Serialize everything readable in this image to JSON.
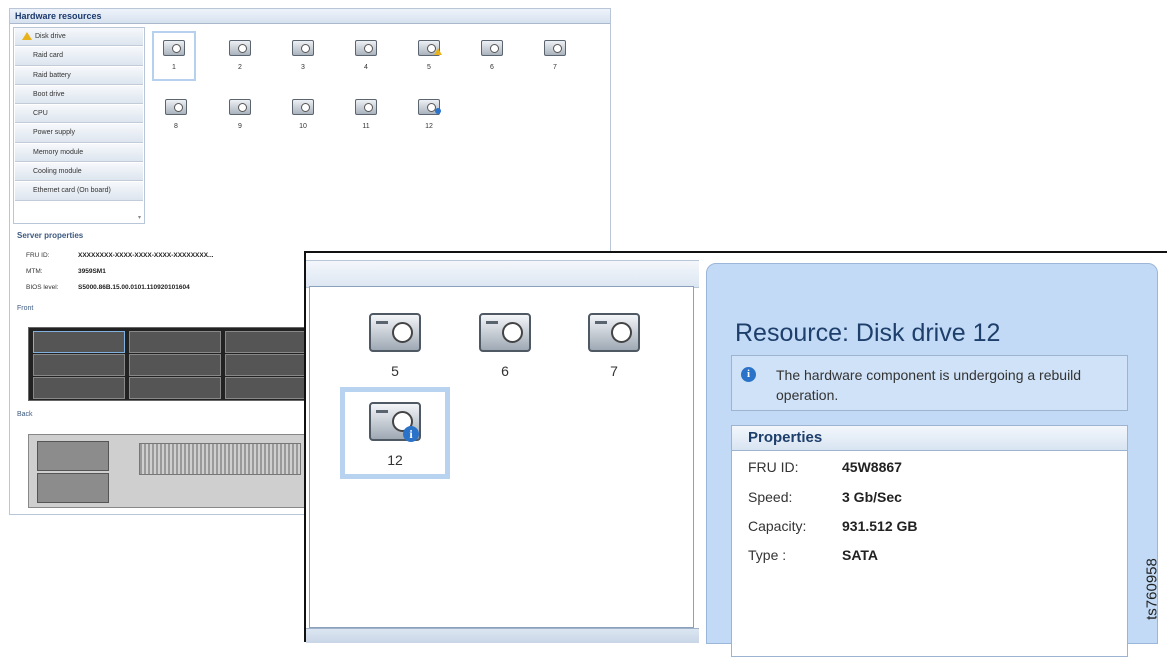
{
  "background_window": {
    "title": "Hardware resources",
    "nav_items": [
      "Disk drive",
      "Raid card",
      "Raid battery",
      "Boot drive",
      "CPU",
      "Power supply",
      "Memory module",
      "Cooling module",
      "Ethernet card (On board)"
    ],
    "disk_numbers": [
      "1",
      "2",
      "3",
      "4",
      "5",
      "6",
      "7",
      "8",
      "9",
      "10",
      "11",
      "12"
    ],
    "server_properties": {
      "title": "Server properties",
      "fru_label": "FRU ID:",
      "fru_value": "XXXXXXXX-XXXX-XXXX-XXXX-XXXXXXXX...",
      "mtm_label": "MTM:",
      "mtm_value": "3959SM1",
      "bios_label": "BIOS level:",
      "bios_value": "S5000.86B.15.00.0101.110920101604"
    },
    "front_label": "Front",
    "back_label": "Back"
  },
  "zoom_window": {
    "disks": [
      "5",
      "6",
      "7",
      "12"
    ],
    "resource_title": "Resource:  Disk drive 12",
    "message": "The hardware component is undergoing a rebuild operation.",
    "properties_title": "Properties",
    "properties": [
      {
        "label": "FRU ID:",
        "value": "45W8867"
      },
      {
        "label": "Speed:",
        "value": "3 Gb/Sec"
      },
      {
        "label": "Capacity:",
        "value": "931.512 GB"
      },
      {
        "label": "Type :",
        "value": "SATA"
      }
    ]
  },
  "figure_tag": "ts760958",
  "colors": {
    "panel_blue": "#c2daf5",
    "accent_blue": "#2b73c8",
    "warning": "#e8b21c",
    "title_blue": "#1e3f6b"
  },
  "icons": {
    "disk": "disk-drive-icon",
    "info": "info-icon",
    "warning": "warning-icon"
  }
}
